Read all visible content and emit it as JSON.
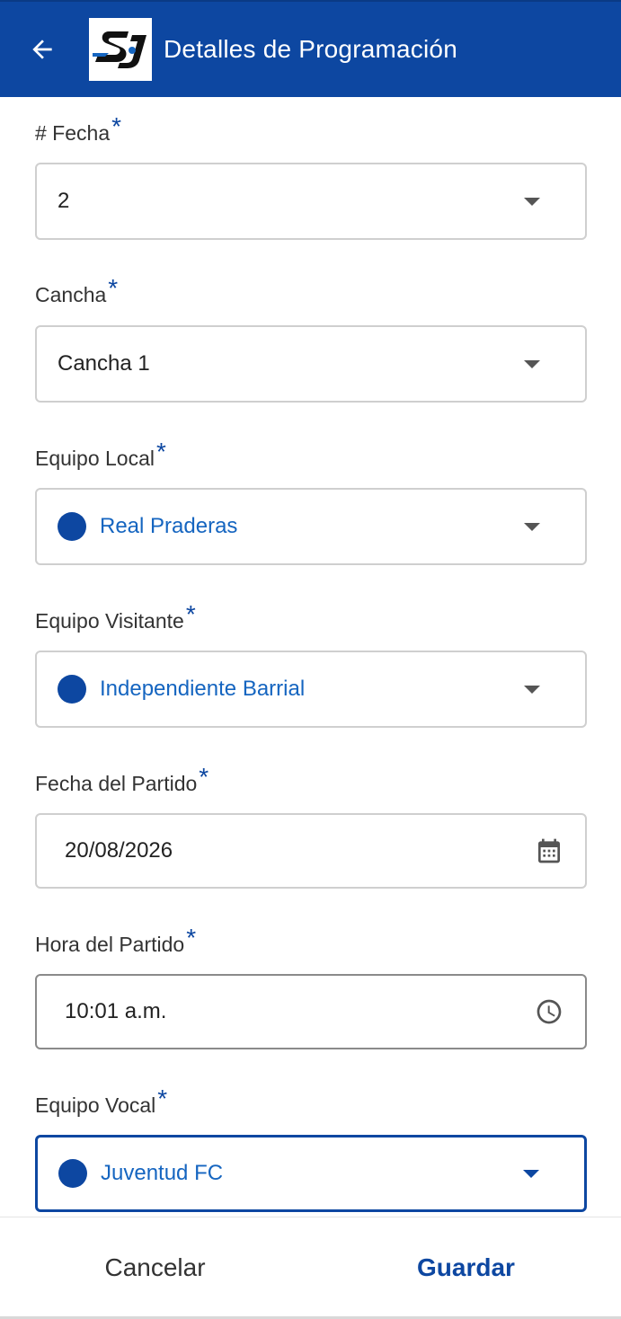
{
  "app_bar": {
    "title": "Detalles de Programación",
    "back_icon": "arrow-left-icon",
    "logo_icon": "sj-logo",
    "background": "#0d47a1"
  },
  "form": {
    "required_mark": "*",
    "fecha_numero": {
      "label": "# Fecha",
      "value": "2"
    },
    "cancha": {
      "label": "Cancha",
      "value": "Cancha 1"
    },
    "equipo_local": {
      "label": "Equipo Local",
      "value": "Real Praderas"
    },
    "equipo_visitante": {
      "label": "Equipo Visitante",
      "value": "Independiente Barrial"
    },
    "fecha_partido": {
      "label": "Fecha del Partido",
      "value": "20/08/2026",
      "icon": "calendar-icon"
    },
    "hora_partido": {
      "label": "Hora del Partido",
      "value": "10:01 a.m.",
      "icon": "clock-icon"
    },
    "equipo_vocal": {
      "label": "Equipo Vocal",
      "value": "Juventud FC"
    }
  },
  "actions": {
    "cancel_label": "Cancelar",
    "save_label": "Guardar"
  },
  "colors": {
    "primary": "#0d47a1",
    "team_text": "#1565c0",
    "border": "#cfcfcf"
  }
}
